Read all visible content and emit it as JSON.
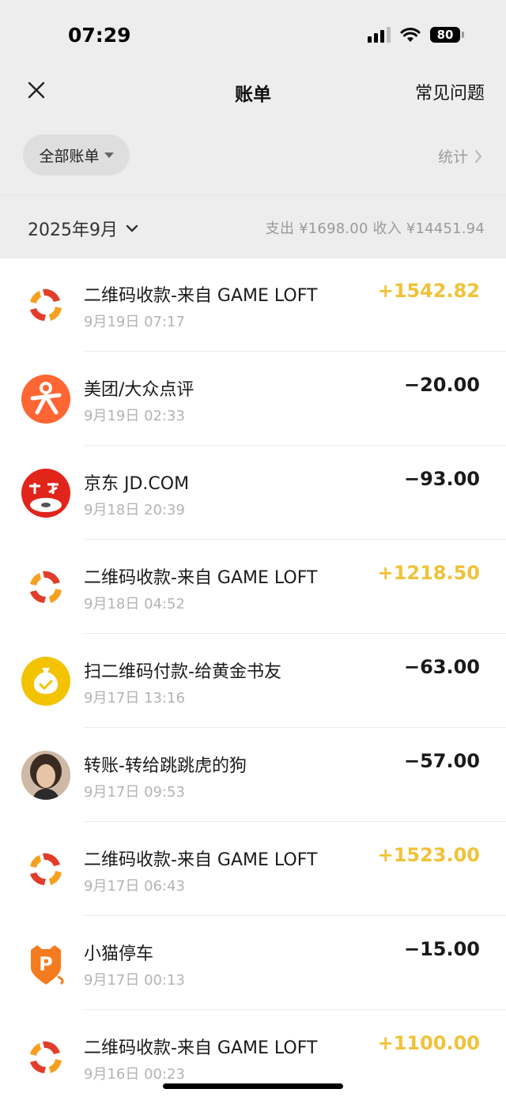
{
  "status_bar": {
    "time": "07:29",
    "battery": "80",
    "wifi_icon": "wifi-icon",
    "signal_icon": "signal-icon"
  },
  "header": {
    "close_icon": "close-icon",
    "title": "账单",
    "faq": "常见问题"
  },
  "filter": {
    "label": "全部账单",
    "stats": "统计"
  },
  "month_bar": {
    "month": "2025年9月",
    "summary": "支出 ¥1698.00   收入 ¥14451.94"
  },
  "colors": {
    "income": "#f0c23a",
    "expense": "#1a1a1a",
    "background_top": "#ededed"
  },
  "transactions": [
    {
      "name": "二维码收款-来自 GAME LOFT",
      "time": "9月19日 07:17",
      "amount": "+1542.82",
      "type": "income",
      "icon": "game-loft-logo-icon"
    },
    {
      "name": "美团/大众点评",
      "time": "9月19日 02:33",
      "amount": "−20.00",
      "type": "expense",
      "icon": "dianping-logo-icon"
    },
    {
      "name": "京东 JD.COM",
      "time": "9月18日 20:39",
      "amount": "−93.00",
      "type": "expense",
      "icon": "jd-logo-icon"
    },
    {
      "name": "二维码收款-来自 GAME LOFT",
      "time": "9月18日 04:52",
      "amount": "+1218.50",
      "type": "income",
      "icon": "game-loft-logo-icon"
    },
    {
      "name": "扫二维码付款-给黄金书友",
      "time": "9月17日 13:16",
      "amount": "−63.00",
      "type": "expense",
      "icon": "money-bag-icon"
    },
    {
      "name": "转账-转给跳跳虎的狗",
      "time": "9月17日 09:53",
      "amount": "−57.00",
      "type": "expense",
      "icon": "user-avatar"
    },
    {
      "name": "二维码收款-来自 GAME LOFT",
      "time": "9月17日 06:43",
      "amount": "+1523.00",
      "type": "income",
      "icon": "game-loft-logo-icon"
    },
    {
      "name": "小猫停车",
      "time": "9月17日 00:13",
      "amount": "−15.00",
      "type": "expense",
      "icon": "parking-cat-logo-icon"
    },
    {
      "name": "二维码收款-来自 GAME LOFT",
      "time": "9月16日 00:23",
      "amount": "+1100.00",
      "type": "income",
      "icon": "game-loft-logo-icon"
    }
  ]
}
